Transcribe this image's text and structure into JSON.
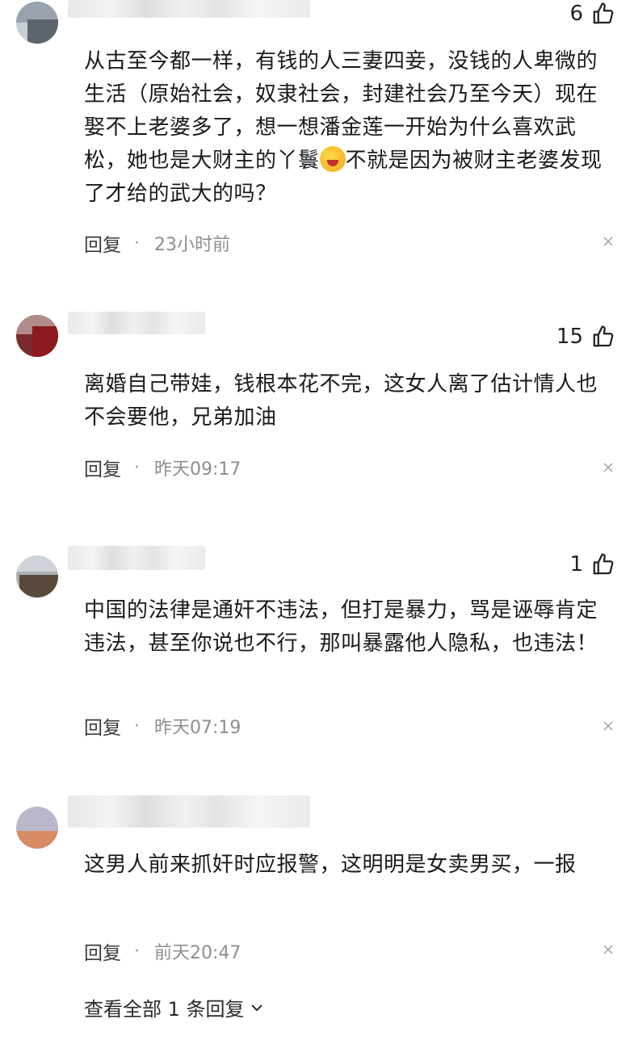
{
  "comments": [
    {
      "likes": "6",
      "text_before": "从古至今都一样，有钱的人三妻四妾，没钱的人卑微的生活（原始社会，奴隶社会，封建社会乃至今天）现在娶不上老婆多了，想一想潘金莲一开始为什么喜欢武松，她也是大财主的丫鬟",
      "text_after": "不就是因为被财主老婆发现了才给的武大的吗？",
      "reply": "回复",
      "dot": "·",
      "time": "23小时前"
    },
    {
      "likes": "15",
      "text": "离婚自己带娃，钱根本花不完，这女人离了估计情人也不会要他，兄弟加油",
      "reply": "回复",
      "dot": "·",
      "time": "昨天09:17"
    },
    {
      "likes": "1",
      "text": "中国的法律是通奸不违法，但打是暴力，骂是诬辱肯定违法，甚至你说也不行，那叫暴露他人隐私，也违法！",
      "reply": "回复",
      "dot": "·",
      "time": "昨天07:19"
    },
    {
      "text": "这男人前来抓奸时应报警，这明明是女卖男买，一报",
      "reply": "回复",
      "dot": "·",
      "time": "前天20:47"
    }
  ],
  "view_all": "查看全部 1 条回复",
  "icons": {
    "like": "thumbs-up-icon",
    "close": "close-icon",
    "expand": "chevron-down-icon",
    "emoji": "laughing-crying-emoji-icon"
  },
  "colors": {
    "meta_time": "#8e8e8e",
    "text": "#1a1a1a"
  }
}
